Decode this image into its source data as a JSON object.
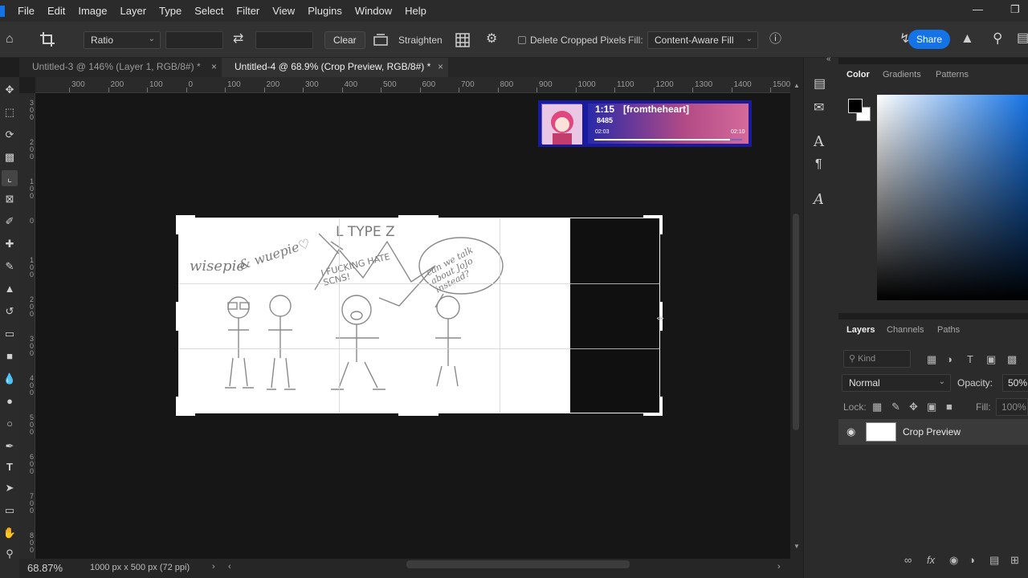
{
  "menubar": {
    "items": [
      "File",
      "Edit",
      "Image",
      "Layer",
      "Type",
      "Select",
      "Filter",
      "View",
      "Plugins",
      "Window",
      "Help"
    ],
    "minimize_icon": "minimize-icon",
    "restore_icon": "restore-icon"
  },
  "options_bar": {
    "ratio_label": "Ratio",
    "clear_label": "Clear",
    "straighten_label": "Straighten",
    "delete_cropped_label": "Delete Cropped Pixels",
    "fill_label": "Fill:",
    "fill_value": "Content-Aware Fill",
    "share_label": "Share"
  },
  "tabs": [
    {
      "label": "Untitled-3 @ 146% (Layer 1, RGB/8#) *"
    },
    {
      "label": "Untitled-4 @ 68.9% (Crop Preview, RGB/8#) *"
    }
  ],
  "ruler_top": [
    "300",
    "200",
    "100",
    "0",
    "100",
    "200",
    "300",
    "400",
    "500",
    "600",
    "700",
    "800",
    "900",
    "1000",
    "1100",
    "1200",
    "1300",
    "1400",
    "1500"
  ],
  "ruler_left": [
    "300",
    "200",
    "100",
    "0",
    "100",
    "200",
    "300",
    "400",
    "500",
    "600",
    "700",
    "800"
  ],
  "music_widget": {
    "time": "1:15",
    "title": "[fromtheheart]",
    "count": "8485",
    "elapsed": "02:03",
    "duration": "02:10",
    "progress": 0.92
  },
  "drawing": {
    "text_wisepie": "wisepie",
    "text_wuepie": "& wuepie♡",
    "text_type": "L TYPE Z",
    "text_shout": "I FUCKING HATE SCNS!",
    "text_bubble": "can we talk about JoJo instead?"
  },
  "status": {
    "zoom": "68.87%",
    "doc_info": "1000 px x 500 px (72 ppi)"
  },
  "color_panel": {
    "tabs": [
      "Color",
      "Gradients",
      "Patterns"
    ],
    "foreground": "#000000",
    "background": "#ffffff",
    "hue": "#1473e6"
  },
  "layers_panel": {
    "tabs": [
      "Layers",
      "Channels",
      "Paths"
    ],
    "search_placeholder": "Kind",
    "blend_mode": "Normal",
    "opacity_label": "Opacity:",
    "opacity_value": "50%",
    "lock_label": "Lock:",
    "fill_label": "Fill:",
    "fill_value": "100%",
    "layer_name": "Crop Preview"
  },
  "colors": {
    "accent": "#1473e6",
    "canvas_bg": "#161616",
    "panel_bg": "#2b2b2b"
  }
}
